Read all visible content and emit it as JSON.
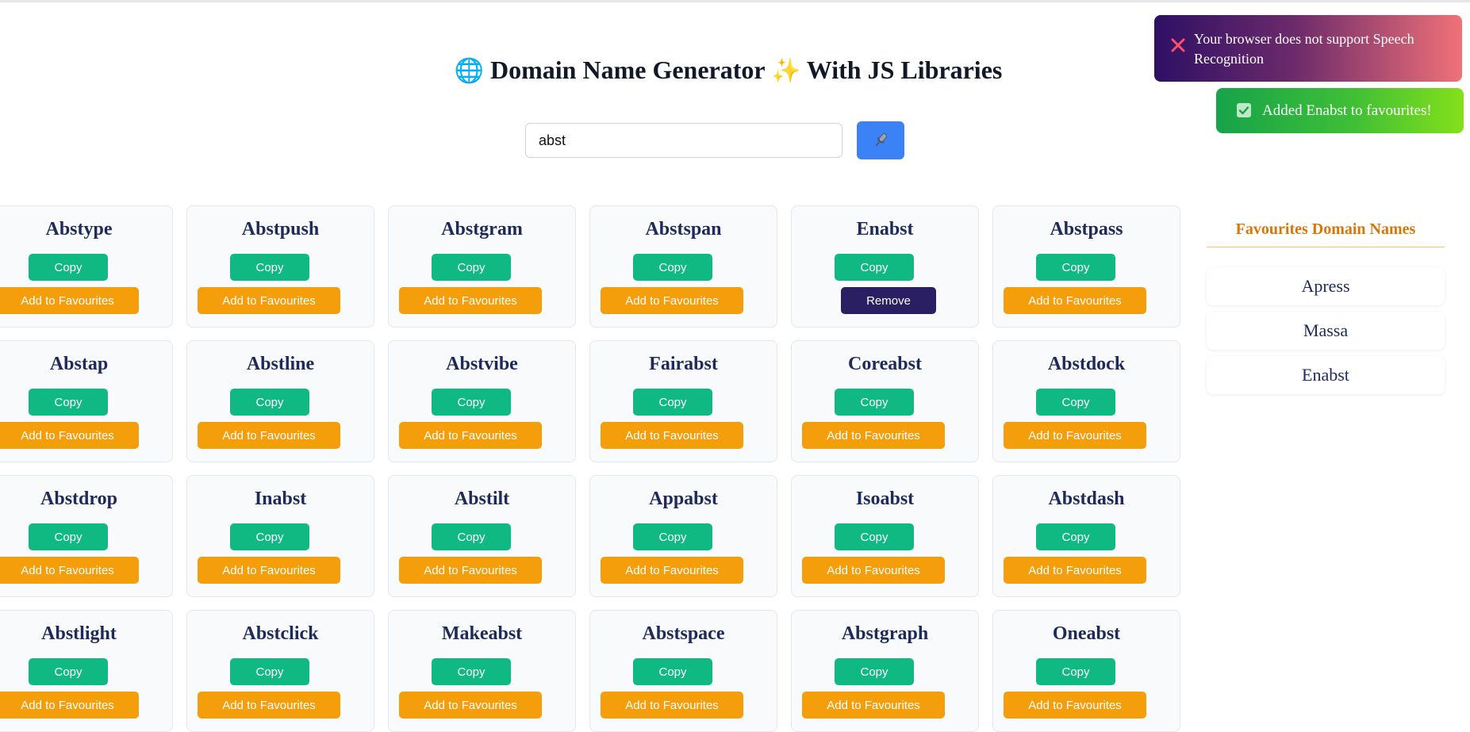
{
  "header": {
    "globe_emoji": "🌐",
    "title_part1": "Domain Name Generator",
    "sparkle_emoji": "✨",
    "title_part2": "With JS Libraries"
  },
  "search": {
    "value": "abst",
    "mic_icon": "microphone-icon"
  },
  "domains": [
    {
      "name": "Abstype",
      "copy_label": "Copy",
      "fav_label": "Add to Favourites"
    },
    {
      "name": "Abstpush",
      "copy_label": "Copy",
      "fav_label": "Add to Favourites"
    },
    {
      "name": "Abstgram",
      "copy_label": "Copy",
      "fav_label": "Add to Favourites"
    },
    {
      "name": "Abstspan",
      "copy_label": "Copy",
      "fav_label": "Add to Favourites"
    },
    {
      "name": "Enabst",
      "copy_label": "Copy",
      "fav_label": "Remove",
      "favourited": true
    },
    {
      "name": "Abstpass",
      "copy_label": "Copy",
      "fav_label": "Add to Favourites"
    },
    {
      "name": "Abstap",
      "copy_label": "Copy",
      "fav_label": "Add to Favourites"
    },
    {
      "name": "Abstline",
      "copy_label": "Copy",
      "fav_label": "Add to Favourites"
    },
    {
      "name": "Abstvibe",
      "copy_label": "Copy",
      "fav_label": "Add to Favourites"
    },
    {
      "name": "Fairabst",
      "copy_label": "Copy",
      "fav_label": "Add to Favourites"
    },
    {
      "name": "Coreabst",
      "copy_label": "Copy",
      "fav_label": "Add to Favourites"
    },
    {
      "name": "Abstdock",
      "copy_label": "Copy",
      "fav_label": "Add to Favourites"
    },
    {
      "name": "Abstdrop",
      "copy_label": "Copy",
      "fav_label": "Add to Favourites"
    },
    {
      "name": "Inabst",
      "copy_label": "Copy",
      "fav_label": "Add to Favourites"
    },
    {
      "name": "Abstilt",
      "copy_label": "Copy",
      "fav_label": "Add to Favourites"
    },
    {
      "name": "Appabst",
      "copy_label": "Copy",
      "fav_label": "Add to Favourites"
    },
    {
      "name": "Isoabst",
      "copy_label": "Copy",
      "fav_label": "Add to Favourites"
    },
    {
      "name": "Abstdash",
      "copy_label": "Copy",
      "fav_label": "Add to Favourites"
    },
    {
      "name": "Abstlight",
      "copy_label": "Copy",
      "fav_label": "Add to Favourites"
    },
    {
      "name": "Abstclick",
      "copy_label": "Copy",
      "fav_label": "Add to Favourites"
    },
    {
      "name": "Makeabst",
      "copy_label": "Copy",
      "fav_label": "Add to Favourites"
    },
    {
      "name": "Abstspace",
      "copy_label": "Copy",
      "fav_label": "Add to Favourites"
    },
    {
      "name": "Abstgraph",
      "copy_label": "Copy",
      "fav_label": "Add to Favourites"
    },
    {
      "name": "Oneabst",
      "copy_label": "Copy",
      "fav_label": "Add to Favourites"
    }
  ],
  "favourites": {
    "title": "Favourites Domain Names",
    "items": [
      "Apress",
      "Massa",
      "Enabst"
    ]
  },
  "toasts": {
    "error": {
      "text": "Your browser does not support Speech Recognition",
      "icon": "close-x-icon"
    },
    "success": {
      "text": "Added Enabst to favourites!",
      "icon": "checkbox-check-icon"
    }
  },
  "colors": {
    "copy": "#10b981",
    "add_favourite": "#f59e0b",
    "remove": "#2a1f63",
    "mic_button": "#3b82f6",
    "favourites_title": "#d97706"
  }
}
